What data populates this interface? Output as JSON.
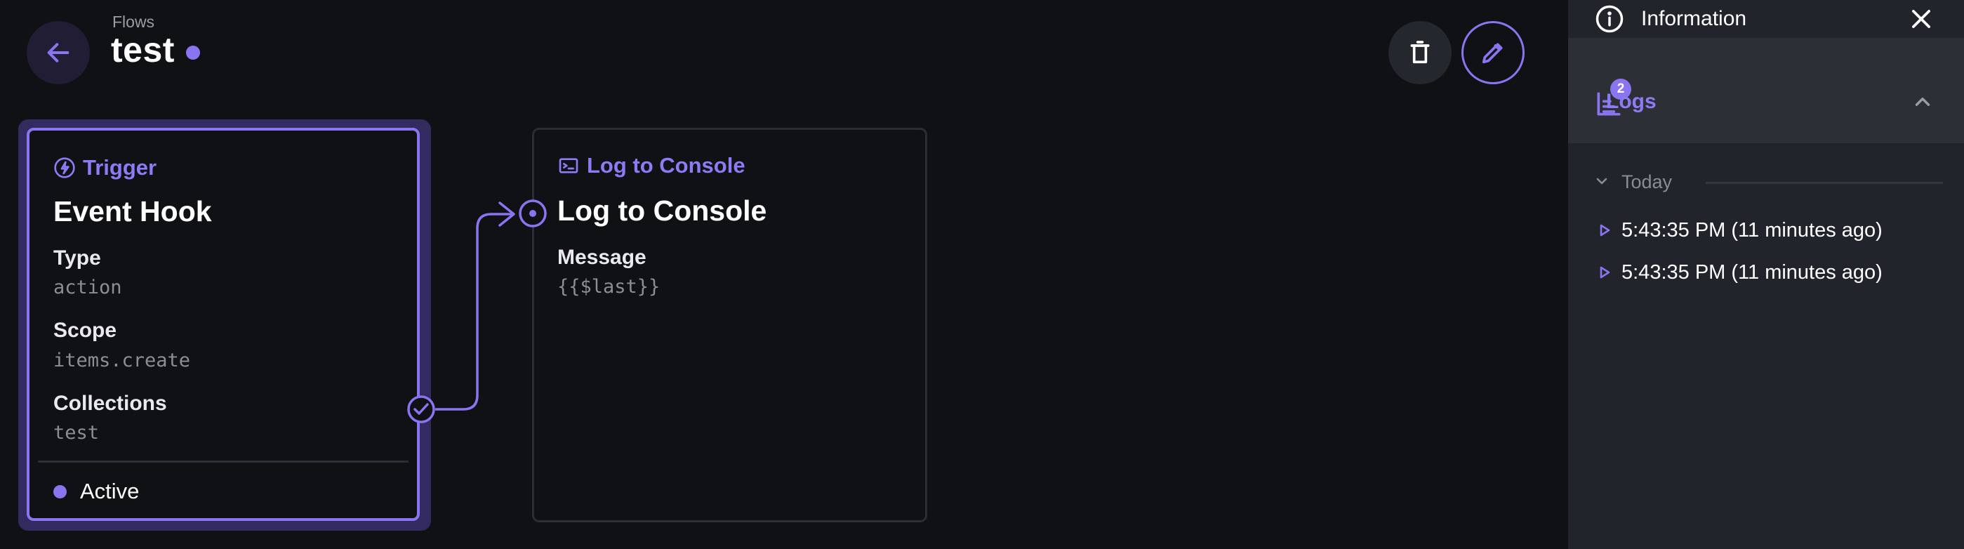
{
  "header": {
    "breadcrumb": "Flows",
    "title": "test"
  },
  "trigger": {
    "header_label": "Trigger",
    "title": "Event Hook",
    "fields": [
      {
        "label": "Type",
        "value": "action"
      },
      {
        "label": "Scope",
        "value": "items.create"
      },
      {
        "label": "Collections",
        "value": "test"
      }
    ],
    "status": "Active"
  },
  "operation": {
    "header_label": "Log to Console",
    "title": "Log to Console",
    "fields": [
      {
        "label": "Message",
        "value": "{{$last}}"
      }
    ]
  },
  "sidebar": {
    "information_label": "Information",
    "logs_label": "Logs",
    "logs_count": "2",
    "group_label": "Today",
    "entries": [
      {
        "text": "5:43:35 PM (11 minutes ago)"
      },
      {
        "text": "5:43:35 PM (11 minutes ago)"
      }
    ]
  },
  "colors": {
    "accent": "#8a74f0",
    "background": "#0f1115",
    "sidebar": "#21242a",
    "border": "#2a2d35"
  },
  "icons": [
    "arrow-left-icon",
    "trash-icon",
    "pencil-icon",
    "bolt-icon",
    "terminal-icon",
    "info-icon",
    "close-icon",
    "logs-icon",
    "chevron-up-icon",
    "chevron-down-icon",
    "play-icon",
    "check-circle-icon",
    "target-circle-icon",
    "arrow-right-icon"
  ]
}
